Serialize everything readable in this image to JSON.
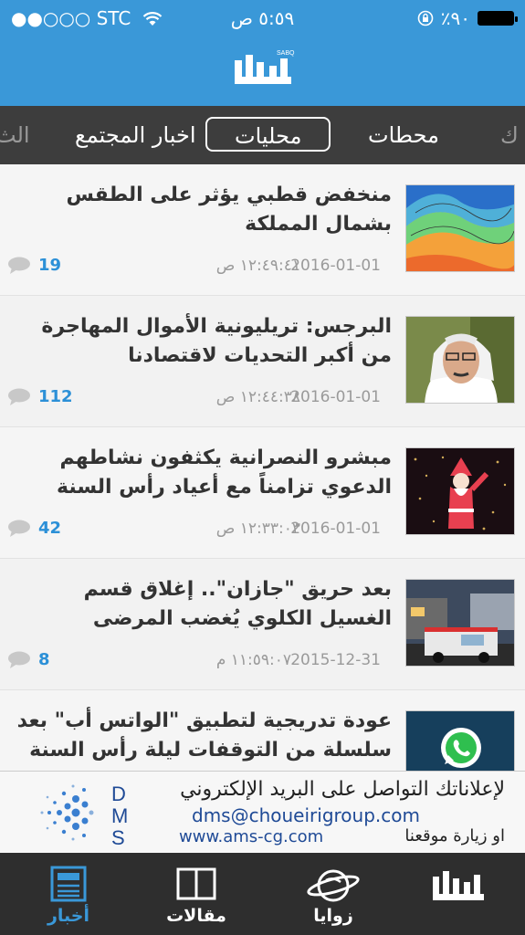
{
  "status_bar": {
    "carrier": "●●○○○ STC",
    "time": "٥:٥٩ ص",
    "battery_percent": "٪٩٠"
  },
  "header": {
    "logo_text": "سبق",
    "logo_sub": "SABQ"
  },
  "tabs": [
    "ك",
    "محطات",
    "محليات",
    "اخبار المجتمع",
    "الث"
  ],
  "active_tab": "محليات",
  "articles": [
    {
      "title": "منخفض قطبي يؤثر على الطقس بشمال المملكة",
      "date": "2016-01-01",
      "time": "١٢:٤٩:٤١ ص",
      "comments": "19",
      "thumb": "weather-map-icon"
    },
    {
      "title": "البرجس: تريليونية الأموال المهاجرة من أكبر التحديات لاقتصادنا",
      "date": "2016-01-01",
      "time": "١٢:٤٤:٣٨ ص",
      "comments": "112",
      "thumb": "person-photo"
    },
    {
      "title": "مبشرو النصرانية يكثفون نشاطهم الدعوي تزامناً مع أعياد رأس السنة",
      "date": "2016-01-01",
      "time": "١٢:٣٣:٠٣ ص",
      "comments": "42",
      "thumb": "santa-lights-photo"
    },
    {
      "title": "بعد حريق \"جازان\".. إغلاق قسم الغسيل الكلوي يُغضب المرضى",
      "date": "2015-12-31",
      "time": "١١:٥٩:٠٧ م",
      "comments": "8",
      "thumb": "fire-truck-photo"
    },
    {
      "title": "عودة تدريجية لتطبيق \"الواتس أب\" بعد سلسلة من التوقفات ليلة رأس السنة",
      "date": "",
      "time": "",
      "comments": "",
      "thumb": "whatsapp-icon"
    }
  ],
  "ad": {
    "brand": "DMS",
    "line1": "لإعلاناتك التواصل على البريد الإلكتروني",
    "email": "dms@choueirigroup.com",
    "line2": "او زيارة موقعنا",
    "website": "www.ams-cg.com"
  },
  "bottom_nav": [
    {
      "label": "",
      "icon": "sabq-logo-icon"
    },
    {
      "label": "زوايا",
      "icon": "globe-pen-icon"
    },
    {
      "label": "مقالات",
      "icon": "book-icon"
    },
    {
      "label": "أخبار",
      "icon": "newspaper-icon"
    }
  ],
  "colors": {
    "accent": "#3a98d8",
    "tabbar": "#3d3d3d",
    "bottom_bar": "#2e2e2e",
    "comment_count": "#2c90d7"
  }
}
